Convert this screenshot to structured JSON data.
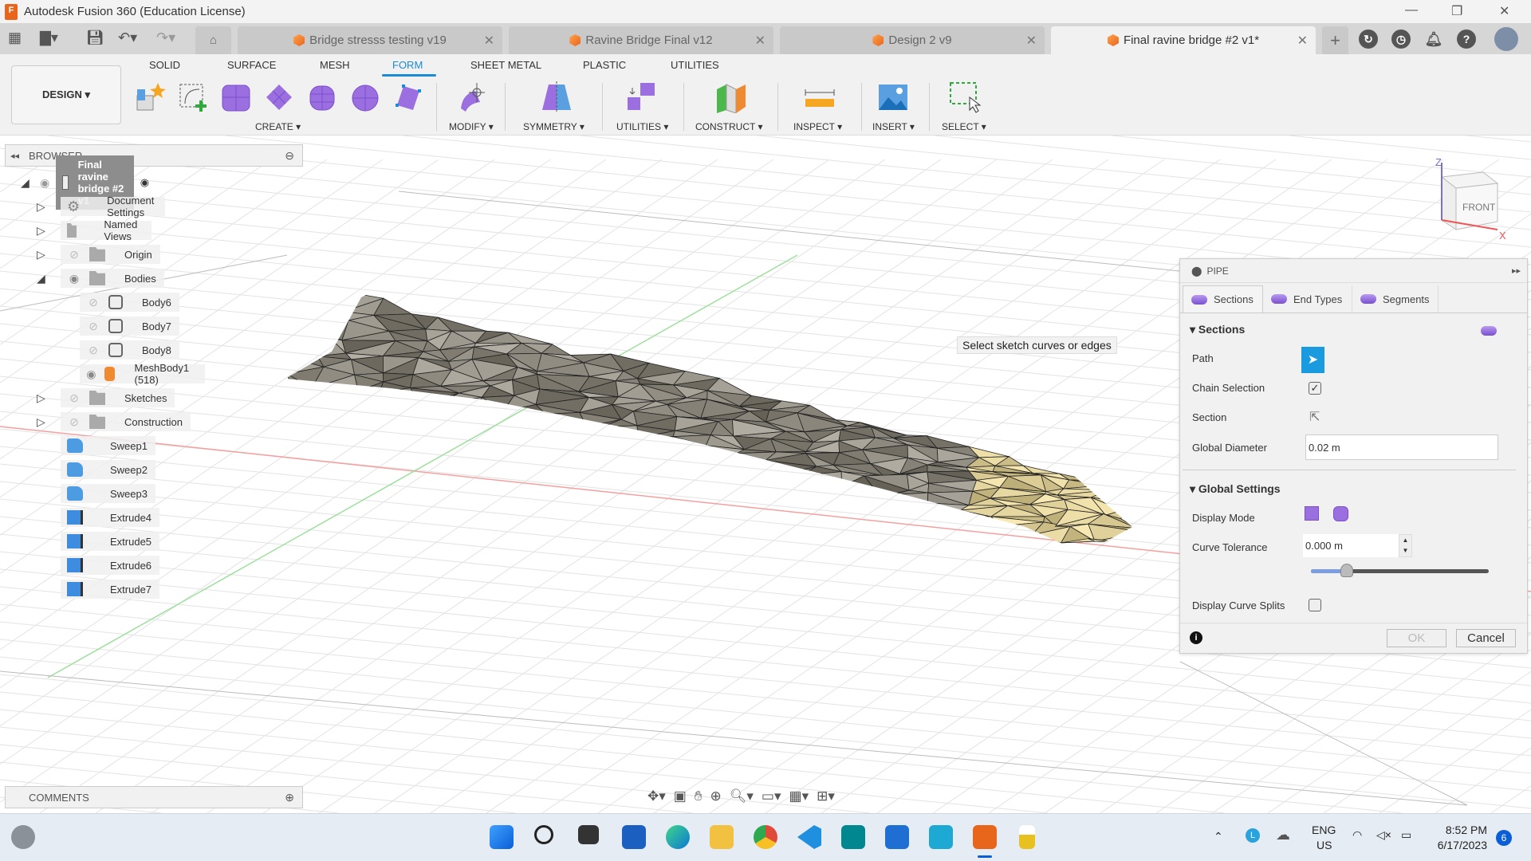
{
  "app": {
    "title": "Autodesk Fusion 360 (Education License)",
    "logo_letter": "F"
  },
  "doc_tabs": [
    {
      "label": "Bridge stresss testing v19",
      "active": false
    },
    {
      "label": "Ravine Bridge Final v12",
      "active": false
    },
    {
      "label": "Design 2 v9",
      "active": false
    },
    {
      "label": "Final ravine bridge #2 v1*",
      "active": true
    }
  ],
  "workspace": {
    "label": "DESIGN ▾"
  },
  "toolbar_tabs": [
    "SOLID",
    "SURFACE",
    "MESH",
    "FORM",
    "SHEET METAL",
    "PLASTIC",
    "UTILITIES"
  ],
  "active_toolbar_tab": "FORM",
  "tool_groups": [
    "CREATE ▾",
    "MODIFY ▾",
    "SYMMETRY ▾",
    "UTILITIES ▾",
    "CONSTRUCT ▾",
    "INSPECT ▾",
    "INSERT ▾",
    "SELECT ▾"
  ],
  "browser": {
    "title": "BROWSER",
    "root": "Final ravine bridge #2 v1",
    "items": [
      {
        "label": "Document Settings"
      },
      {
        "label": "Named Views"
      },
      {
        "label": "Origin"
      },
      {
        "label": "Bodies"
      },
      {
        "label": "Body6"
      },
      {
        "label": "Body7"
      },
      {
        "label": "Body8"
      },
      {
        "label": "MeshBody1 (518)"
      },
      {
        "label": "Sketches"
      },
      {
        "label": "Construction"
      },
      {
        "label": "Sweep1"
      },
      {
        "label": "Sweep2"
      },
      {
        "label": "Sweep3"
      },
      {
        "label": "Extrude4"
      },
      {
        "label": "Extrude5"
      },
      {
        "label": "Extrude6"
      },
      {
        "label": "Extrude7"
      }
    ]
  },
  "comments": {
    "title": "COMMENTS"
  },
  "viewcube": {
    "face": "FRONT",
    "axis_z": "Z",
    "axis_x": "X"
  },
  "tooltip": "Select sketch curves or edges",
  "pipe": {
    "title": "PIPE",
    "tabs": [
      "Sections",
      "End Types",
      "Segments"
    ],
    "sections_heading": "Sections",
    "path_label": "Path",
    "chain_label": "Chain Selection",
    "chain_checked": true,
    "section_label": "Section",
    "diameter_label": "Global Diameter",
    "diameter_value": "0.02 m",
    "global_heading": "Global Settings",
    "display_mode_label": "Display Mode",
    "tolerance_label": "Curve Tolerance",
    "tolerance_value": "0.000 m",
    "tolerance_slider": 0.2,
    "splits_label": "Display Curve Splits",
    "splits_checked": false,
    "ok": "OK",
    "cancel": "Cancel"
  },
  "tray": {
    "lang1": "ENG",
    "lang2": "US",
    "time": "8:52 PM",
    "date": "6/17/2023",
    "badge": "6"
  },
  "colors": {
    "accent": "#1a8bd6",
    "form_purple": "#9b6fe0",
    "mesh_gray": "#8a857a",
    "mesh_tan": "#b9a76e"
  }
}
